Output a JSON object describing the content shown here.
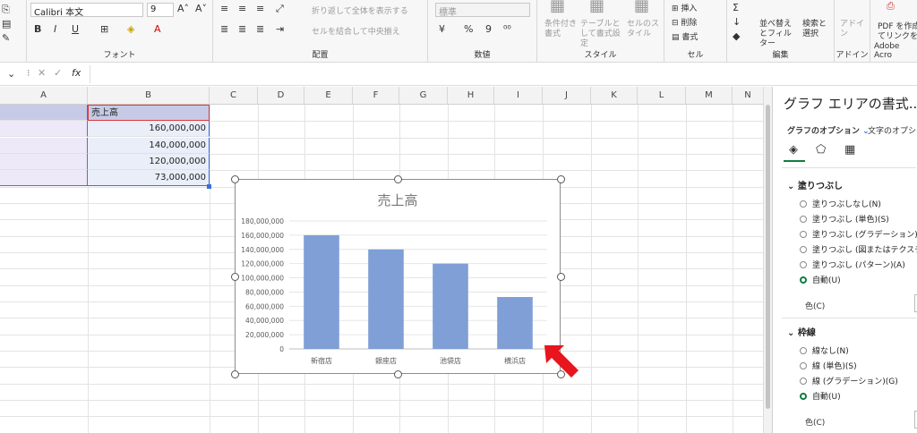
{
  "ribbon": {
    "font_name": "Calibri 本文",
    "font_size": "9",
    "grow_font": "A˄",
    "shrink_font": "A˅",
    "bold": "B",
    "italic": "I",
    "underline": "U",
    "font_group": "フォント",
    "wrap_text": "折り返して全体を表示する",
    "merge_center": "セルを結合して中央揃え",
    "align_group": "配置",
    "number_format": "標準",
    "percent": "%",
    "comma": "9",
    "number_group": "数値",
    "cond_format": "条件付き書式",
    "table_format": "テーブルとして書式設定",
    "cell_style": "セルのスタイル",
    "style_group": "スタイル",
    "insert": "挿入",
    "delete": "削除",
    "format": "書式",
    "cells_group": "セル",
    "sort_filter": "並べ替えとフィルター",
    "find_select": "検索と選択",
    "edit_group": "編集",
    "addin": "アドイン",
    "addin_group": "アドイン",
    "pdf_create": "PDF を作成",
    "pdf_link": "てリンクを共",
    "acrobat_group": "Adobe Acro"
  },
  "formula_bar": {
    "fx": "fx"
  },
  "columns": [
    "A",
    "B",
    "C",
    "D",
    "E",
    "F",
    "G",
    "H",
    "I",
    "J",
    "K",
    "L",
    "M",
    "N"
  ],
  "sheet": {
    "b_header": "売上高",
    "values": [
      "160,000,000",
      "140,000,000",
      "120,000,000",
      "73,000,000"
    ]
  },
  "chart_data": {
    "type": "bar",
    "title": "売上高",
    "categories": [
      "新宿店",
      "銀座店",
      "池袋店",
      "横浜店"
    ],
    "values": [
      160000000,
      140000000,
      120000000,
      73000000
    ],
    "ylim": [
      0,
      180000000
    ],
    "yticks": [
      "0",
      "20,000,000",
      "40,000,000",
      "60,000,000",
      "80,000,000",
      "100,000,000",
      "120,000,000",
      "140,000,000",
      "160,000,000",
      "180,000,000"
    ],
    "color": "#7f9fd6",
    "grid": true
  },
  "pane": {
    "title": "グラフ エリアの書式...",
    "tab_chart_options": "グラフのオプション",
    "tab_text_options": "文字のオプショ",
    "fill_section": "塗りつぶし",
    "fill_options": [
      "塗りつぶしなし(N)",
      "塗りつぶし (単色)(S)",
      "塗りつぶし (グラデーション)(G)",
      "塗りつぶし (図またはテクスチャ)(P)",
      "塗りつぶし (パターン)(A)",
      "自動(U)"
    ],
    "fill_color_label": "色(C)",
    "line_section": "枠線",
    "line_options": [
      "線なし(N)",
      "線 (単色)(S)",
      "線 (グラデーション)(G)",
      "自動(U)"
    ],
    "line_color_label": "色(C)"
  },
  "colors": {
    "accent_green": "#107c41",
    "arrow_red": "#e8141e",
    "bar_blue": "#7f9fd6"
  }
}
